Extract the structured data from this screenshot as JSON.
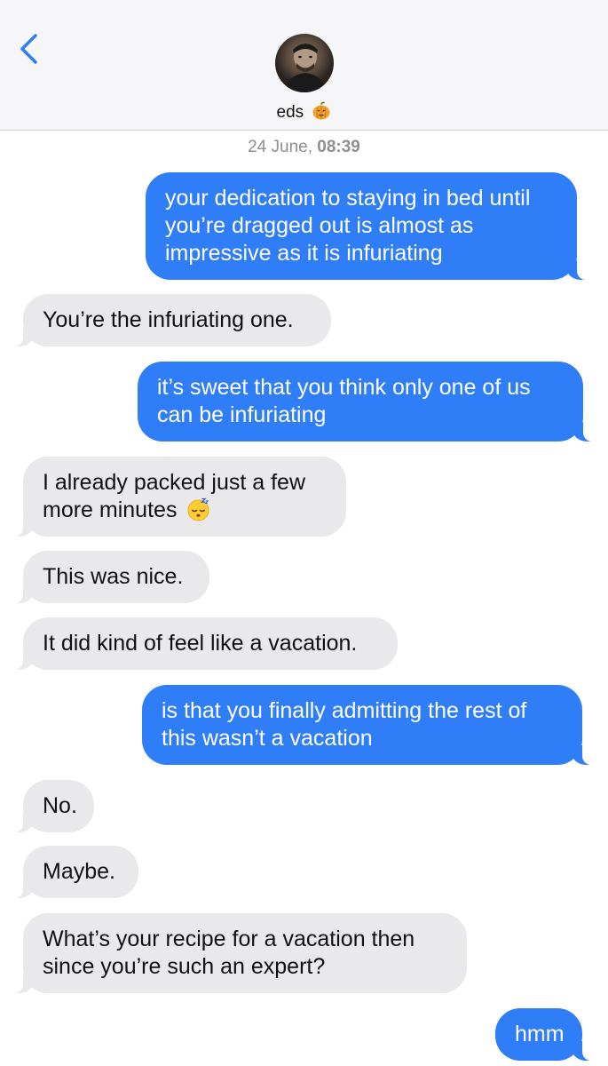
{
  "header": {
    "contact_name": "eds",
    "contact_emoji": "pumpkin-icon",
    "back_icon": "chevron-left-icon",
    "accent_color": "#2f7ef7"
  },
  "timestamp": {
    "date": "24 June,",
    "time": "08:39"
  },
  "messages": [
    {
      "direction": "sent",
      "text": "your dedication to staying in bed until you’re dragged out is almost as impressive as it is infuriating"
    },
    {
      "direction": "received",
      "text": "You’re the infuriating one."
    },
    {
      "direction": "sent",
      "text": "it’s sweet that you think only one of us can be infuriating"
    },
    {
      "direction": "received",
      "text": "I already packed just a few more minutes",
      "emoji": "sleeping-face-icon"
    },
    {
      "direction": "received",
      "text": "This was nice."
    },
    {
      "direction": "received",
      "text": "It did kind of feel like a vacation."
    },
    {
      "direction": "sent",
      "text": "is that you finally admitting the rest of this wasn’t a vacation"
    },
    {
      "direction": "received",
      "text": "No."
    },
    {
      "direction": "received",
      "text": "Maybe."
    },
    {
      "direction": "received",
      "text": "What’s your recipe for a vacation then since you’re such an expert?"
    },
    {
      "direction": "sent",
      "text": "hmm"
    }
  ],
  "colors": {
    "sent_bubble": "#2f7ef7",
    "received_bubble": "#e9e9ec",
    "header_bg": "#f6f6f8"
  }
}
